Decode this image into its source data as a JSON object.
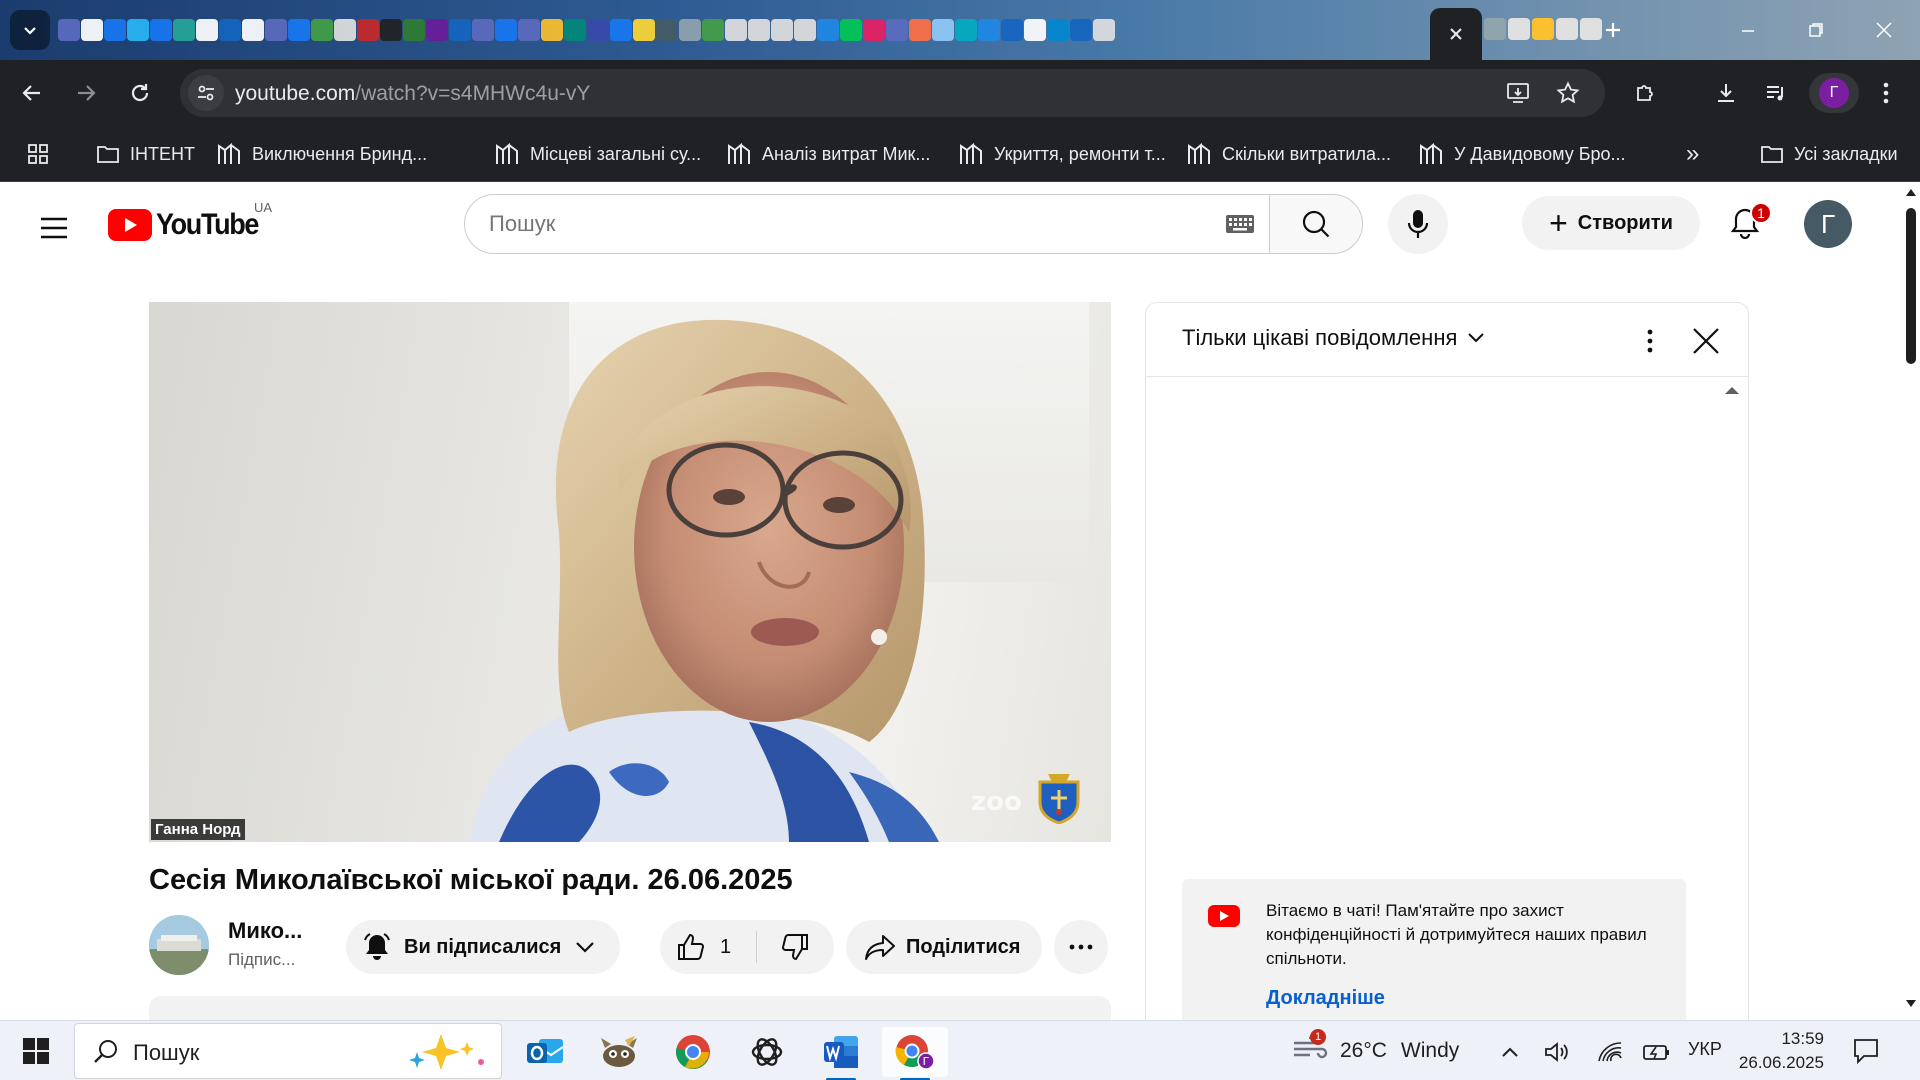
{
  "browser": {
    "url_host": "youtube.com",
    "url_path": "/watch?v=s4MHWc4u-vY",
    "profile_initial": "Г",
    "bookmarks": [
      {
        "label": "ІНТЕНТ",
        "icon": "folder-icon"
      },
      {
        "label": "Виключення Бринд...",
        "icon": "site-icon"
      },
      {
        "label": "Місцеві загальні су...",
        "icon": "site-icon"
      },
      {
        "label": "Аналіз витрат Мик...",
        "icon": "site-icon"
      },
      {
        "label": "Укриття, ремонти т...",
        "icon": "site-icon"
      },
      {
        "label": "Скільки витратила...",
        "icon": "site-icon"
      },
      {
        "label": "У Давидовому Бро...",
        "icon": "site-icon"
      }
    ],
    "all_bookmarks_label": "Усі закладки",
    "overflow_label": "»"
  },
  "youtube": {
    "logo_text": "YouTube",
    "country_code": "UA",
    "search_placeholder": "Пошук",
    "create_label": "Створити",
    "notification_count": "1",
    "avatar_initial": "Г",
    "video": {
      "speaker_label": "Ганна Норд",
      "watermark": "zoo",
      "title": "Сесія Миколаївської міської ради. 26.06.2025",
      "channel_name": "Мико...",
      "channel_subs": "Підпис...",
      "subscribed_label": "Ви підписалися",
      "like_count": "1",
      "share_label": "Поділитися"
    },
    "chat": {
      "mode_label": "Тільки цікаві повідомлення",
      "welcome_text": "Вітаємо в чаті! Пам'ятайте про захист конфіденційності й дотримуйтеся наших правил спільноти.",
      "learn_more": "Докладніше"
    }
  },
  "taskbar": {
    "search_label": "Пошук",
    "weather_temp": "26°C",
    "weather_desc": "Windy",
    "weather_badge": "1",
    "language": "УКР",
    "time": "13:59",
    "date": "26.06.2025"
  },
  "colors": {
    "youtube_red": "#ff0000",
    "link_blue": "#065fd4",
    "browser_dark": "#202124",
    "notif_red": "#cc0000"
  }
}
